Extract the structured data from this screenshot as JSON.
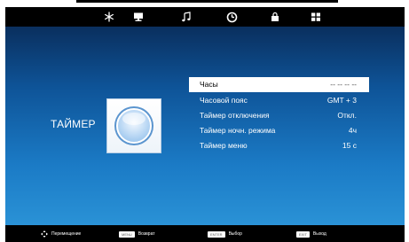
{
  "tabs": [
    {
      "name": "picture",
      "icon": "snowflake-icon",
      "active": false
    },
    {
      "name": "screen",
      "icon": "monitor-icon",
      "active": false
    },
    {
      "name": "sound",
      "icon": "music-note-icon",
      "active": false
    },
    {
      "name": "time",
      "icon": "clock-icon",
      "active": true
    },
    {
      "name": "lock",
      "icon": "lock-icon",
      "active": false
    },
    {
      "name": "setup",
      "icon": "grid-icon",
      "active": false
    }
  ],
  "section": {
    "title": "ТАЙМЕР",
    "icon": "clock-icon"
  },
  "menu": {
    "items": [
      {
        "label": "Часы",
        "value": "-- -- -- --",
        "selected": true
      },
      {
        "label": "Часовой пояс",
        "value": "GMT + 3",
        "selected": false
      },
      {
        "label": "Таймер отключения",
        "value": "Откл.",
        "selected": false
      },
      {
        "label": "Таймер ночн. режима",
        "value": "4ч",
        "selected": false
      },
      {
        "label": "Таймер меню",
        "value": "15 с",
        "selected": false
      }
    ]
  },
  "footer": {
    "move": {
      "icon": "arrows-icon",
      "label": "Перемещение"
    },
    "back": {
      "key": "MENU",
      "label": "Возврат"
    },
    "select": {
      "key": "ENTER",
      "label": "Выбор"
    },
    "exit": {
      "key": "EXIT",
      "label": "Выход"
    }
  },
  "colors": {
    "bar": "#000000",
    "bg_top": "#0a2f5e",
    "bg_bottom": "#2a92d6",
    "selection": "#ffffff"
  }
}
